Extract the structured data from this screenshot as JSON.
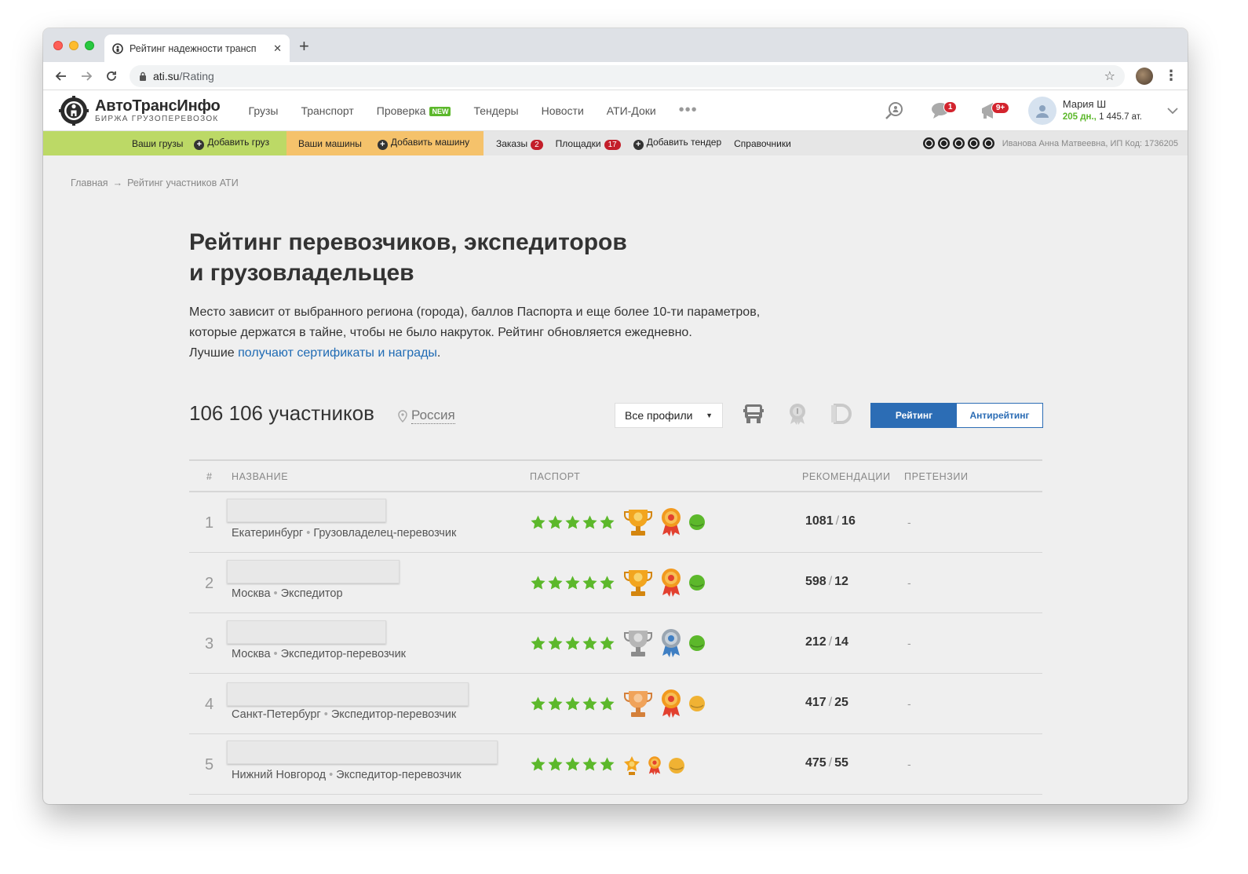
{
  "browser": {
    "tab_title": "Рейтинг надежности трансп",
    "tab_close": "✕",
    "new_tab": "+",
    "url_host": "ati.su",
    "url_path": "/Rating"
  },
  "header": {
    "brand": "АвтоТрансИнфо",
    "tagline": "БИРЖА ГРУЗОПЕРЕВОЗОК",
    "nav": [
      {
        "label": "Грузы"
      },
      {
        "label": "Транспорт"
      },
      {
        "label": "Проверка",
        "badge": "NEW"
      },
      {
        "label": "Тендеры"
      },
      {
        "label": "Новости"
      },
      {
        "label": "АТИ-Доки"
      }
    ],
    "more": "•••",
    "messages_count": "1",
    "notifications_count": "9+",
    "user_name": "Мария Ш",
    "user_days": "205 дн.,",
    "user_balance": "1 445.7 ат."
  },
  "subnav": {
    "your_cargo": "Ваши грузы",
    "add_cargo": "Добавить груз",
    "your_trucks": "Ваши машины",
    "add_truck": "Добавить машину",
    "orders": "Заказы",
    "orders_count": "2",
    "platforms": "Площадки",
    "platforms_count": "17",
    "add_tender": "Добавить тендер",
    "directories": "Справочники",
    "company": "Иванова Анна Матвеевна, ИП  Код: 1736205"
  },
  "breadcrumb": {
    "home": "Главная",
    "arrow": "→",
    "current": "Рейтинг участников АТИ"
  },
  "page": {
    "title_line1": "Рейтинг перевозчиков, экспедиторов",
    "title_line2": "и грузовладельцев",
    "intro_line1": "Место зависит от выбранного региона (города), баллов Паспорта и еще более 10-ти параметров,",
    "intro_line2": "которые держатся в тайне, чтобы не было накруток. Рейтинг обновляется ежедневно.",
    "intro_line3_prefix": "Лучшие ",
    "intro_link": "получают сертификаты и награды",
    "intro_line3_suffix": "."
  },
  "filters": {
    "participants": "106 106 участников",
    "region": "Россия",
    "profile_select": "Все профили",
    "toggle_rating": "Рейтинг",
    "toggle_antirating": "Антирейтинг"
  },
  "table": {
    "headers": {
      "num": "#",
      "name": "НАЗВАНИЕ",
      "passport": "ПАСПОРТ",
      "recommendations": "РЕКОМЕНДАЦИИ",
      "claims": "ПРЕТЕНЗИИ"
    },
    "rows": [
      {
        "rank": "1",
        "city": "Екатеринбург",
        "type": "Грузовладелец-перевозчик",
        "rec": "1081",
        "rec_neg": "16",
        "claims": "-",
        "cup": "gold",
        "status": "green"
      },
      {
        "rank": "2",
        "city": "Москва",
        "type": "Экспедитор",
        "rec": "598",
        "rec_neg": "12",
        "claims": "-",
        "cup": "gold",
        "status": "green"
      },
      {
        "rank": "3",
        "city": "Москва",
        "type": "Экспедитор-перевозчик",
        "rec": "212",
        "rec_neg": "14",
        "claims": "-",
        "cup": "silver",
        "status": "green"
      },
      {
        "rank": "4",
        "city": "Санкт-Петербург",
        "type": "Экспедитор-перевозчик",
        "rec": "417",
        "rec_neg": "25",
        "claims": "-",
        "cup": "bronze",
        "status": "yellow"
      },
      {
        "rank": "5",
        "city": "Нижний Новгород",
        "type": "Экспедитор-перевозчик",
        "rec": "475",
        "rec_neg": "55",
        "claims": "-",
        "cup": "star",
        "status": "yellow"
      }
    ]
  },
  "colors": {
    "accent": "#2c6db5",
    "green": "#5cb82b",
    "subnav_green": "#bcd966",
    "subnav_orange": "#f5c26b",
    "badge_red": "#d3242e"
  }
}
